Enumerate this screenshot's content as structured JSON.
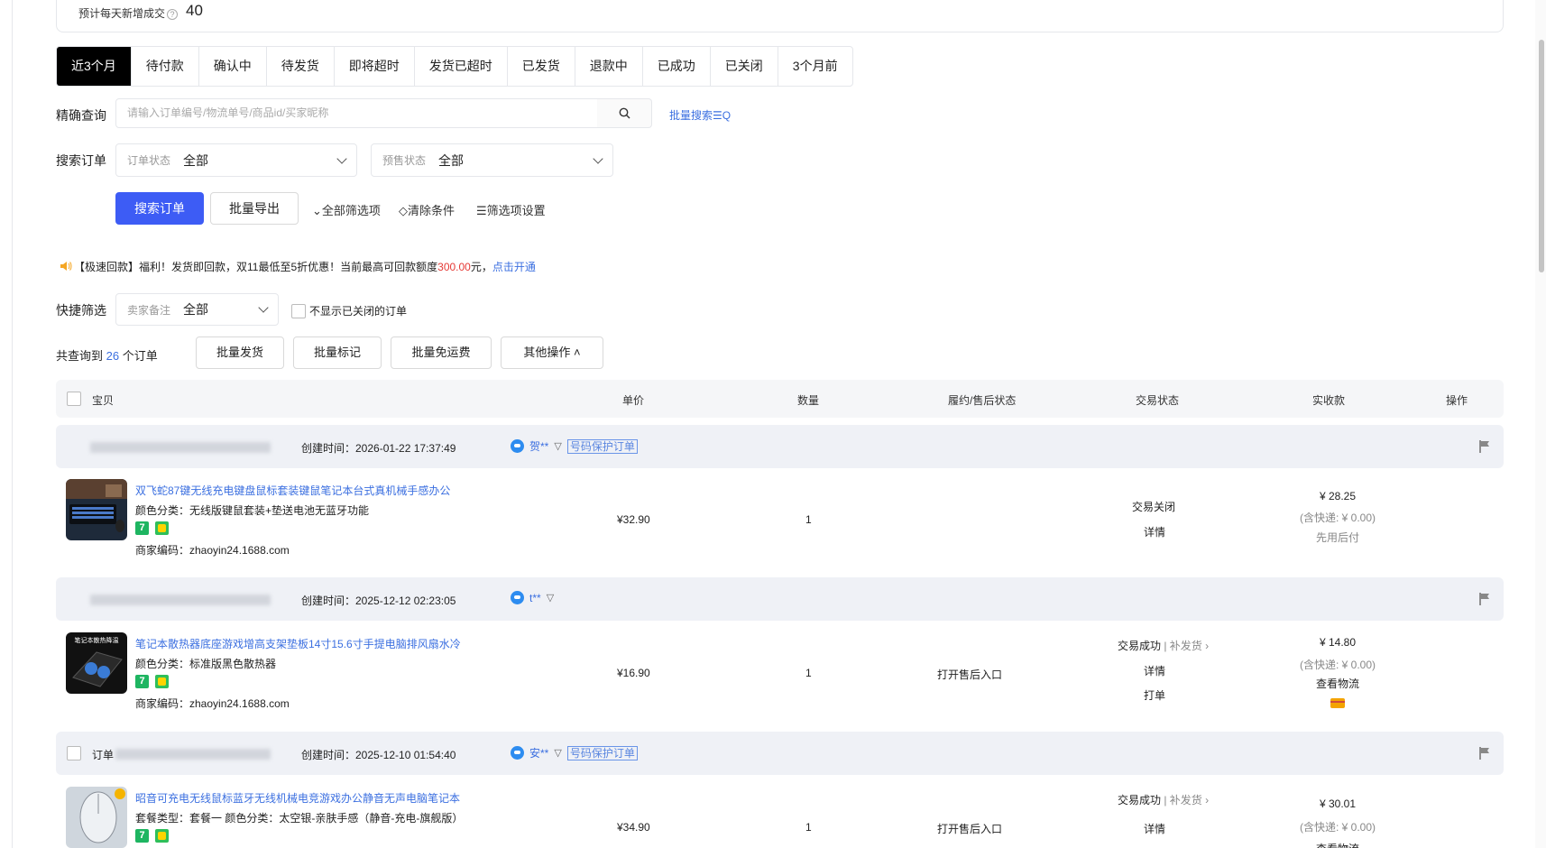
{
  "stats": {
    "label": "预计每天新增成交",
    "value": "40"
  },
  "tabs": [
    "近3个月",
    "待付款",
    "确认中",
    "待发货",
    "即将超时",
    "发货已超时",
    "已发货",
    "退款中",
    "已成功",
    "已关闭",
    "3个月前"
  ],
  "search": {
    "label": "精确查询",
    "placeholder": "请输入订单编号/物流单号/商品id/买家昵称",
    "batch_search": "批量搜索☰Q"
  },
  "filters": {
    "label": "搜索订单",
    "order_status_label": "订单状态",
    "order_status_value": "全部",
    "presale_label": "预售状态",
    "presale_value": "全部"
  },
  "actions": {
    "search_btn": "搜索订单",
    "export_btn": "批量导出",
    "all_filters": "⌄全部筛选项",
    "clear": "◇清除条件",
    "settings": "☰筛选项设置"
  },
  "notice": {
    "prefix": "【极速回款】福利！发货即回款，双11最低至5折优惠！当前最高可回款额度",
    "amount": "300.00",
    "mid": "元，",
    "link": "点击开通"
  },
  "quick": {
    "label": "快捷筛选",
    "seller_note_label": "卖家备注",
    "seller_note_value": "全部",
    "hide_closed": "不显示已关闭的订单"
  },
  "summary": {
    "prefix": "共查询到",
    "count": "26",
    "suffix": "个订单",
    "batch_ship": "批量发货",
    "batch_mark": "批量标记",
    "batch_free": "批量免运费",
    "other_ops": "其他操作 ˄"
  },
  "table_headers": {
    "item": "宝贝",
    "price": "单价",
    "qty": "数量",
    "after_sale": "履约/售后状态",
    "trade_status": "交易状态",
    "received": "实收款",
    "ops": "操作"
  },
  "orders": [
    {
      "created": "创建时间：2026-01-22 17:37:49",
      "buyer": "贺**",
      "tag": "号码保护订单",
      "title": "双飞蛇87键无线充电键盘鼠标套装键鼠笔记本台式真机械手感办公",
      "spec": "颜色分类：无线版键鼠套装+垫送电池无蓝牙功能",
      "merchant_code": "商家编码：zhaoyin24.1688.com",
      "price": "¥32.90",
      "qty": "1",
      "after_sale": "",
      "status": "交易关闭",
      "detail": "详情",
      "received": "¥ 28.25",
      "shipping": "(含快递: ¥ 0.00)",
      "extra": "先用后付"
    },
    {
      "created": "创建时间：2025-12-12 02:23:05",
      "buyer": "t**",
      "title": "笔记本散热器底座游戏增高支架垫板14寸15.6寸手提电脑排风扇水冷",
      "spec": "颜色分类：标准版黑色散热器",
      "merchant_code": "商家编码：zhaoyin24.1688.com",
      "price": "¥16.90",
      "qty": "1",
      "after_sale": "打开售后入口",
      "status": "交易成功",
      "status_extra": "| 补发货 ›",
      "detail": "详情",
      "print": "打单",
      "received": "¥ 14.80",
      "shipping": "(含快递: ¥ 0.00)",
      "extra": "查看物流"
    },
    {
      "order_label": "订单",
      "created": "创建时间：2025-12-10 01:54:40",
      "buyer": "安**",
      "tag": "号码保护订单",
      "title": "昭音可充电无线鼠标蓝牙无线机械电竞游戏办公静音无声电脑笔记本",
      "spec": "套餐类型：套餐一  颜色分类：太空银-亲肤手感（静音-充电-旗舰版）",
      "price": "¥34.90",
      "qty": "1",
      "after_sale": "打开售后入口",
      "status": "交易成功",
      "status_extra": "| 补发货 ›",
      "detail": "详情",
      "received": "¥ 30.01",
      "shipping": "(含快递: ¥ 0.00)",
      "extra": "查看物流"
    }
  ],
  "colors": {
    "primary": "#3d5cf5",
    "link": "#3b6fe0",
    "tab_active": "#000000",
    "alert": "#e53935"
  },
  "thumb_texts": {
    "cooler": "笔记本散热降温"
  }
}
